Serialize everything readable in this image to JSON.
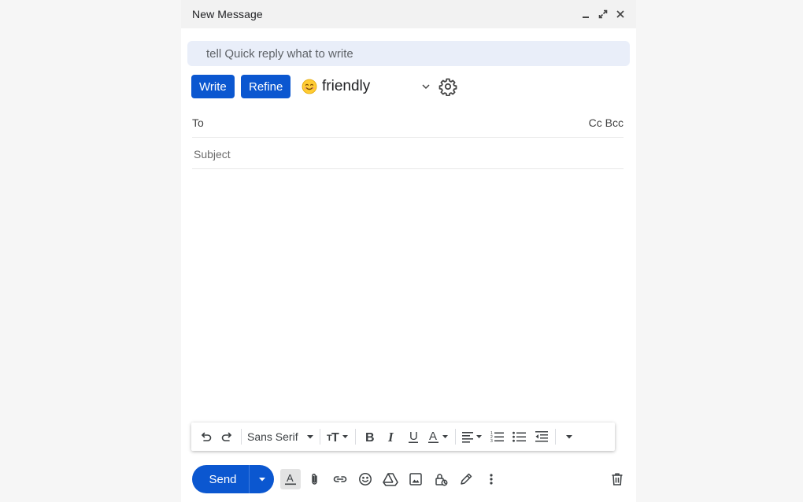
{
  "window": {
    "title": "New Message",
    "controls": [
      "minimize-icon",
      "expand-icon",
      "close-icon"
    ]
  },
  "prompt": {
    "placeholder": "tell Quick reply what to write"
  },
  "actions": {
    "write_label": "Write",
    "refine_label": "Refine",
    "tone_emoji": "smiling-face-icon",
    "tone_label": "friendly"
  },
  "fields": {
    "to_label": "To",
    "cc_bcc_label": "Cc Bcc",
    "subject_placeholder": "Subject"
  },
  "formatting": {
    "font_family": "Sans Serif",
    "icons": [
      "undo-icon",
      "redo-icon",
      "text-size-icon",
      "bold-icon",
      "italic-icon",
      "underline-icon",
      "text-color-icon",
      "align-icon",
      "numbered-list-icon",
      "bulleted-list-icon",
      "indent-less-icon",
      "more-formatting-icon"
    ]
  },
  "bottom": {
    "send_label": "Send",
    "icons": [
      "formatting-options-icon",
      "attach-icon",
      "link-icon",
      "emoji-icon",
      "drive-icon",
      "photo-icon",
      "confidential-icon",
      "signature-icon",
      "more-options-icon",
      "trash-icon"
    ]
  },
  "colors": {
    "accent": "#0b57d0",
    "prompt_bg": "#e9eef9",
    "titlebar_bg": "#f2f2f2"
  }
}
